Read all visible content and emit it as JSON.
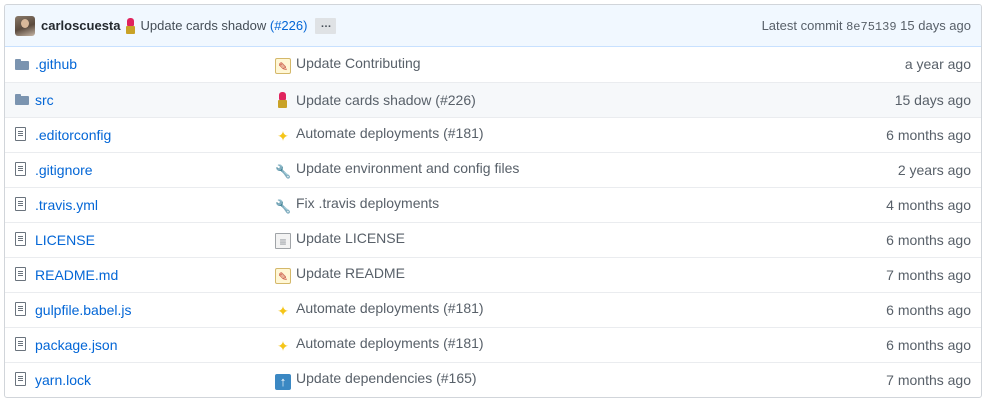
{
  "commit": {
    "author": "carloscuesta",
    "emoji": "lipstick-icon",
    "message": "Update cards shadow ",
    "pr_link": "(#226)",
    "ellipsis": "…",
    "latest_label": "Latest commit",
    "sha": "8e75139",
    "age": "15 days ago"
  },
  "files": [
    {
      "type": "folder",
      "name": ".github",
      "emoji": "memo-icon",
      "message": "Update Contributing",
      "age": "a year ago"
    },
    {
      "type": "folder",
      "name": "src",
      "emoji": "lipstick-icon",
      "message": "Update cards shadow (#226)",
      "age": "15 days ago"
    },
    {
      "type": "file",
      "name": ".editorconfig",
      "emoji": "sparkles-icon",
      "message": "Automate deployments (#181)",
      "age": "6 months ago"
    },
    {
      "type": "file",
      "name": ".gitignore",
      "emoji": "wrench-icon",
      "message": "Update environment and config files",
      "age": "2 years ago"
    },
    {
      "type": "file",
      "name": ".travis.yml",
      "emoji": "wrench-icon",
      "message": "Fix .travis deployments",
      "age": "4 months ago"
    },
    {
      "type": "file",
      "name": "LICENSE",
      "emoji": "page-icon",
      "message": "Update LICENSE",
      "age": "6 months ago"
    },
    {
      "type": "file",
      "name": "README.md",
      "emoji": "memo-icon",
      "message": "Update README",
      "age": "7 months ago"
    },
    {
      "type": "file",
      "name": "gulpfile.babel.js",
      "emoji": "sparkles-icon",
      "message": "Automate deployments (#181)",
      "age": "6 months ago"
    },
    {
      "type": "file",
      "name": "package.json",
      "emoji": "sparkles-icon",
      "message": "Automate deployments (#181)",
      "age": "6 months ago"
    },
    {
      "type": "file",
      "name": "yarn.lock",
      "emoji": "arrow-up-icon",
      "message": "Update dependencies (#165)",
      "age": "7 months ago"
    }
  ],
  "colors": {
    "link": "#0366d6",
    "commit_bar_bg": "#f1f8ff",
    "highlight_row": "#f6f8fa",
    "muted_text": "#586069"
  }
}
